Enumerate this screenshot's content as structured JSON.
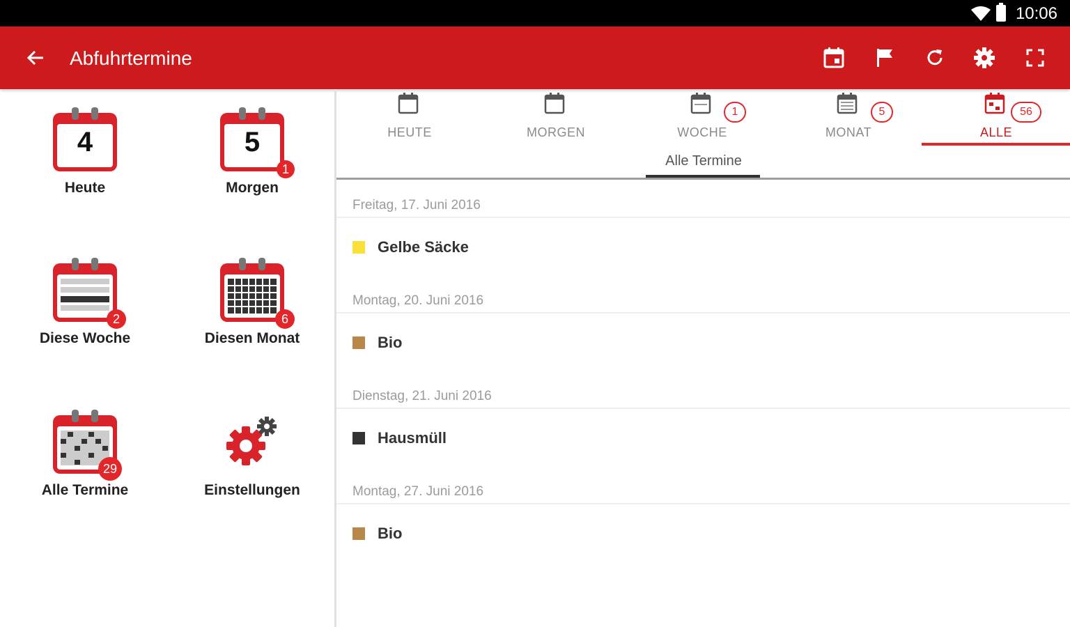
{
  "status": {
    "time": "10:06"
  },
  "toolbar": {
    "title": "Abfuhrtermine",
    "bg": "#cc1a1d"
  },
  "tiles": [
    {
      "label": "Heute",
      "num": "4",
      "badge": ""
    },
    {
      "label": "Morgen",
      "num": "5",
      "badge": "1"
    },
    {
      "label": "Diese Woche",
      "badge": "2"
    },
    {
      "label": "Diesen Monat",
      "badge": "6"
    },
    {
      "label": "Alle Termine",
      "badge": "29"
    },
    {
      "label": "Einstellungen"
    }
  ],
  "tabs": [
    {
      "label": "HEUTE",
      "count": ""
    },
    {
      "label": "MORGEN",
      "count": ""
    },
    {
      "label": "WOCHE",
      "count": "1"
    },
    {
      "label": "MONAT",
      "count": "5"
    },
    {
      "label": "ALLE",
      "count": "56"
    }
  ],
  "subtab": "Alle Termine",
  "groups": [
    {
      "date": "Freitag, 17. Juni 2016",
      "item": "Gelbe Säcke",
      "color": "#f9e03a"
    },
    {
      "date": "Montag, 20. Juni 2016",
      "item": "Bio",
      "color": "#b8874a"
    },
    {
      "date": "Dienstag, 21. Juni 2016",
      "item": "Hausmüll",
      "color": "#333333"
    },
    {
      "date": "Montag, 27. Juni 2016",
      "item": "Bio",
      "color": "#b8874a"
    }
  ]
}
